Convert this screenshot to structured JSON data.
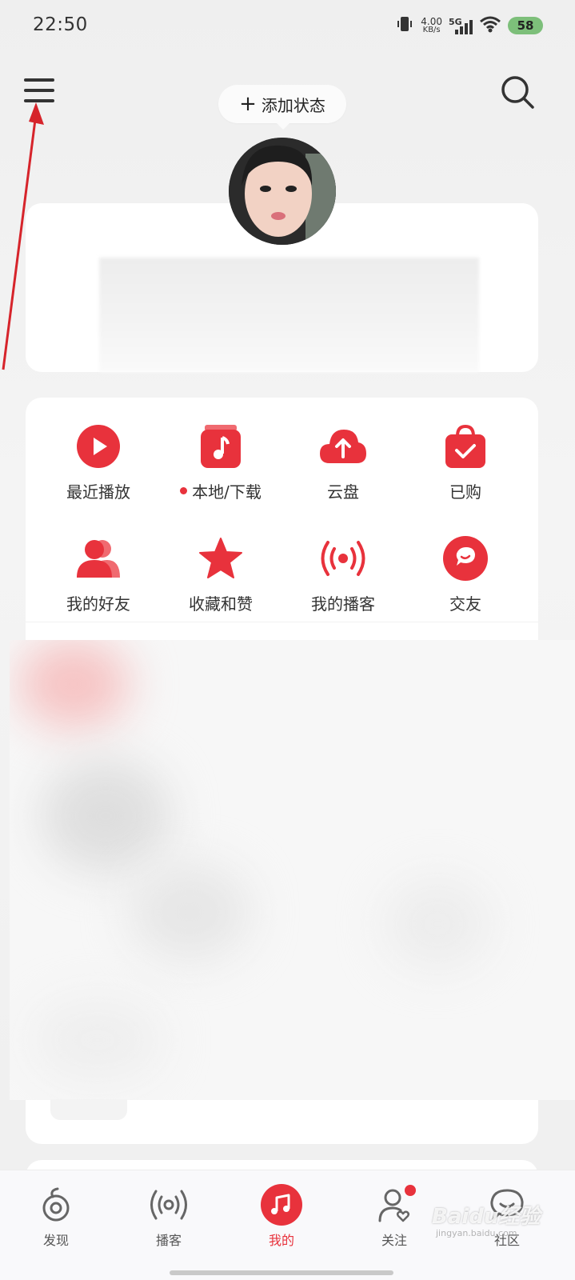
{
  "status_bar": {
    "time": "22:50",
    "speed_value": "4.00",
    "speed_unit": "KB/s",
    "network": "5G",
    "battery": "58"
  },
  "header": {
    "add_status_label": "添加状态"
  },
  "quick_grid": {
    "items": [
      {
        "label": "最近播放",
        "icon": "play-circle-icon"
      },
      {
        "label": "本地/下载",
        "icon": "local-music-icon",
        "dot": true
      },
      {
        "label": "云盘",
        "icon": "cloud-upload-icon"
      },
      {
        "label": "已购",
        "icon": "shopping-bag-check-icon"
      },
      {
        "label": "我的好友",
        "icon": "friends-icon"
      },
      {
        "label": "收藏和赞",
        "icon": "star-icon"
      },
      {
        "label": "我的播客",
        "icon": "podcast-broadcast-icon"
      },
      {
        "label": "交友",
        "icon": "chat-bubble-icon"
      }
    ]
  },
  "bottom_nav": {
    "items": [
      {
        "label": "发现",
        "icon": "discover-icon"
      },
      {
        "label": "播客",
        "icon": "podcast-icon"
      },
      {
        "label": "我的",
        "icon": "music-note-icon",
        "active": true
      },
      {
        "label": "关注",
        "icon": "follow-user-icon",
        "badge": true
      },
      {
        "label": "社区",
        "icon": "community-icon"
      }
    ]
  },
  "watermark": {
    "text": "Baidu经验",
    "sub": "jingyan.baidu.com"
  },
  "colors": {
    "accent": "#e8323c",
    "background": "#efefef",
    "card": "#ffffff"
  }
}
